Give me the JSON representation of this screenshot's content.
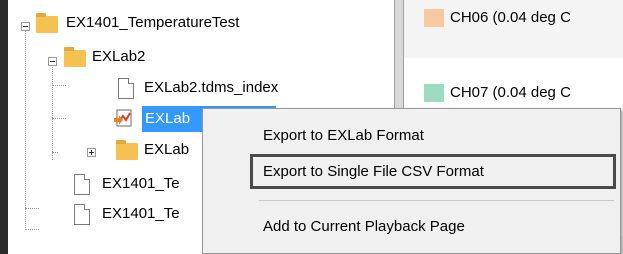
{
  "tree": {
    "root": {
      "label": "EX1401_TemperatureTest",
      "expanded": true
    },
    "folder": {
      "label": "EXLab2",
      "expanded": true
    },
    "items": [
      {
        "label": "EXLab2.tdms_index",
        "type": "file"
      },
      {
        "label": "EXLab",
        "type": "data",
        "selected": true
      },
      {
        "label": "EXLab",
        "type": "folder",
        "expanded": false
      }
    ],
    "root_files": [
      {
        "label": "EX1401_Te"
      },
      {
        "label": "EX1401_Te"
      }
    ]
  },
  "channels": [
    {
      "label": "CH06 (0.04 deg C",
      "color": "#f7c9a0"
    },
    {
      "label": "CH07 (0.04 deg C",
      "color": "#9ddcc0"
    }
  ],
  "context_menu": {
    "items": [
      {
        "label": "Export to EXLab Format",
        "highlighted": false
      },
      {
        "label": "Export to Single File CSV Format",
        "highlighted": true
      },
      {
        "label": "Add to Current Playback Page",
        "highlighted": false
      }
    ]
  },
  "colors": {
    "selection": "#3399ff",
    "folder": "#f5c252",
    "menu_background": "#f0f0f0",
    "highlight_border": "#4a4a4a"
  }
}
